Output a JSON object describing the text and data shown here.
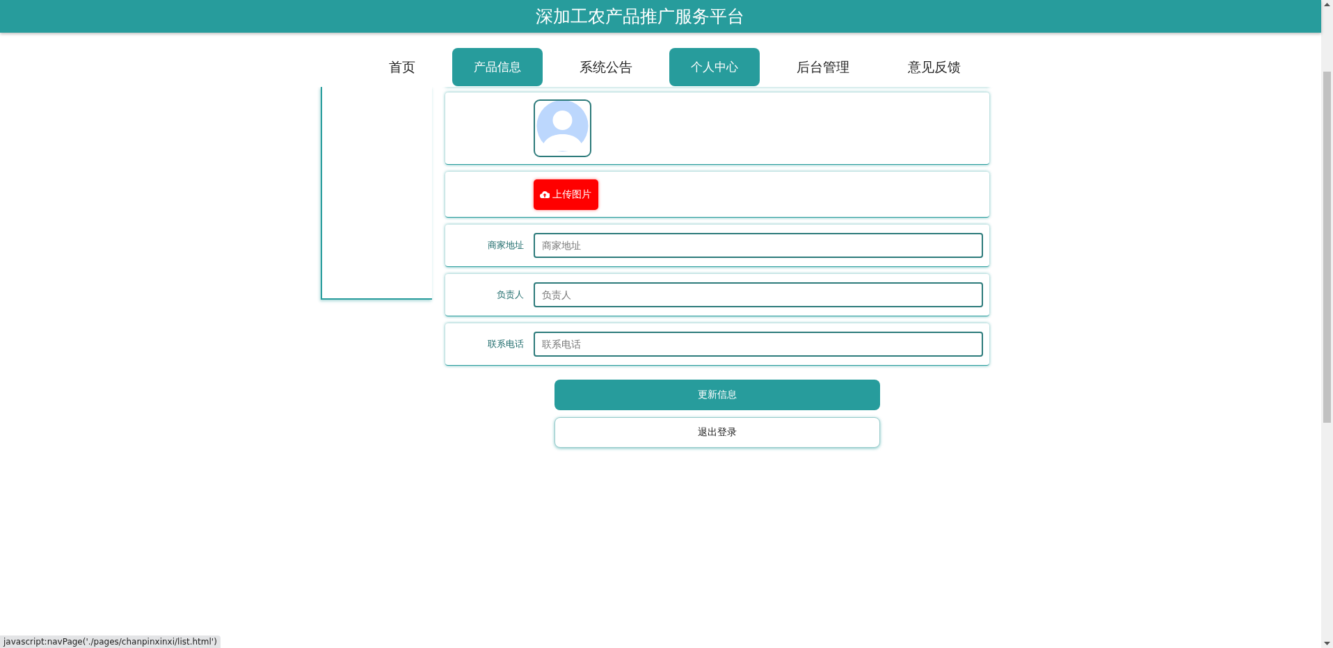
{
  "header": {
    "title": "深加工农产品推广服务平台"
  },
  "nav": [
    {
      "label": "首页",
      "highlighted": false
    },
    {
      "label": "产品信息",
      "highlighted": true
    },
    {
      "label": "系统公告",
      "highlighted": false
    },
    {
      "label": "个人中心",
      "highlighted": true
    },
    {
      "label": "后台管理",
      "highlighted": false
    },
    {
      "label": "意见反馈",
      "highlighted": false
    }
  ],
  "form": {
    "upload_button": "上传图片",
    "fields": [
      {
        "label": "商家地址",
        "placeholder": "商家地址"
      },
      {
        "label": "负责人",
        "placeholder": "负责人"
      },
      {
        "label": "联系电话",
        "placeholder": "联系电话"
      }
    ]
  },
  "buttons": [
    {
      "kind": "primary",
      "label": "更新信息"
    },
    {
      "kind": "outline",
      "label": "退出登录"
    }
  ],
  "status_tip": "javascript:navPage('./pages/chanpinxinxi/list.html')"
}
